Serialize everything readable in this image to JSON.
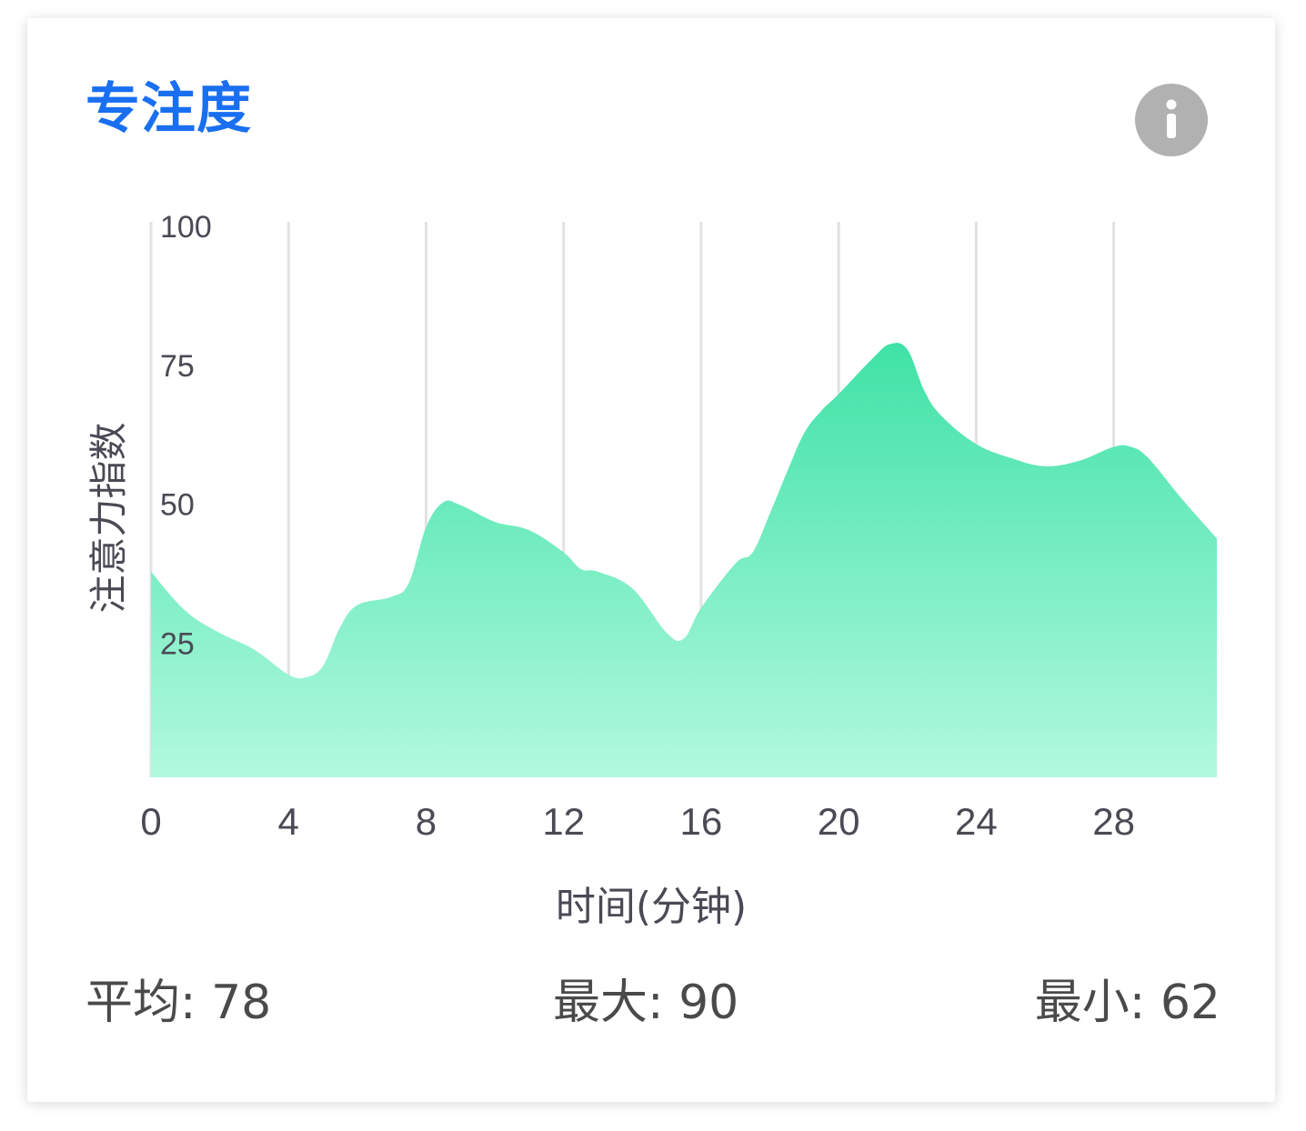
{
  "card": {
    "title": "专注度",
    "info_icon": "info-icon"
  },
  "colors": {
    "title": "#1a6ff0",
    "area_top": "#3fe2a6",
    "area_bottom": "#b2f9df",
    "grid": "#e2e2e2",
    "axis_text": "#4a4a55",
    "icon_bg": "#b1b1b1",
    "icon_fg": "#ffffff"
  },
  "chart_data": {
    "type": "area",
    "title": "",
    "xlabel": "时间(分钟)",
    "ylabel": "注意力指数",
    "xlim": [
      0,
      31
    ],
    "ylim": [
      0,
      100
    ],
    "x_ticks": [
      0,
      4,
      8,
      12,
      16,
      20,
      24,
      28
    ],
    "y_ticks": [
      25,
      50,
      75,
      100
    ],
    "grid": "vertical",
    "series": [
      {
        "x": [
          0,
          1,
          2,
          3,
          4,
          4.5,
          5,
          5.5,
          6,
          7,
          7.5,
          8,
          8.5,
          9,
          10,
          11,
          12,
          12.5,
          13,
          14,
          15,
          15.5,
          16,
          17,
          17.5,
          18,
          18.5,
          19,
          19.5,
          20,
          21,
          21.5,
          22,
          22.5,
          23,
          24,
          25,
          26,
          27,
          28,
          28.5,
          29,
          30,
          31
        ],
        "y": [
          37,
          30,
          26,
          23,
          18.5,
          18,
          20,
          27,
          31,
          32.5,
          35,
          45,
          49.5,
          49,
          46,
          44.5,
          40.5,
          37.5,
          37,
          34,
          26,
          25,
          30.5,
          38.5,
          40.5,
          47.5,
          55,
          62,
          66,
          69,
          75.5,
          78,
          77,
          69.5,
          65,
          60,
          57.5,
          56,
          57,
          59.5,
          59.5,
          57.5,
          50,
          43
        ]
      }
    ]
  },
  "stats": {
    "avg_label": "平均:",
    "avg_value": "78",
    "max_label": "最大:",
    "max_value": "90",
    "min_label": "最小:",
    "min_value": "62"
  }
}
